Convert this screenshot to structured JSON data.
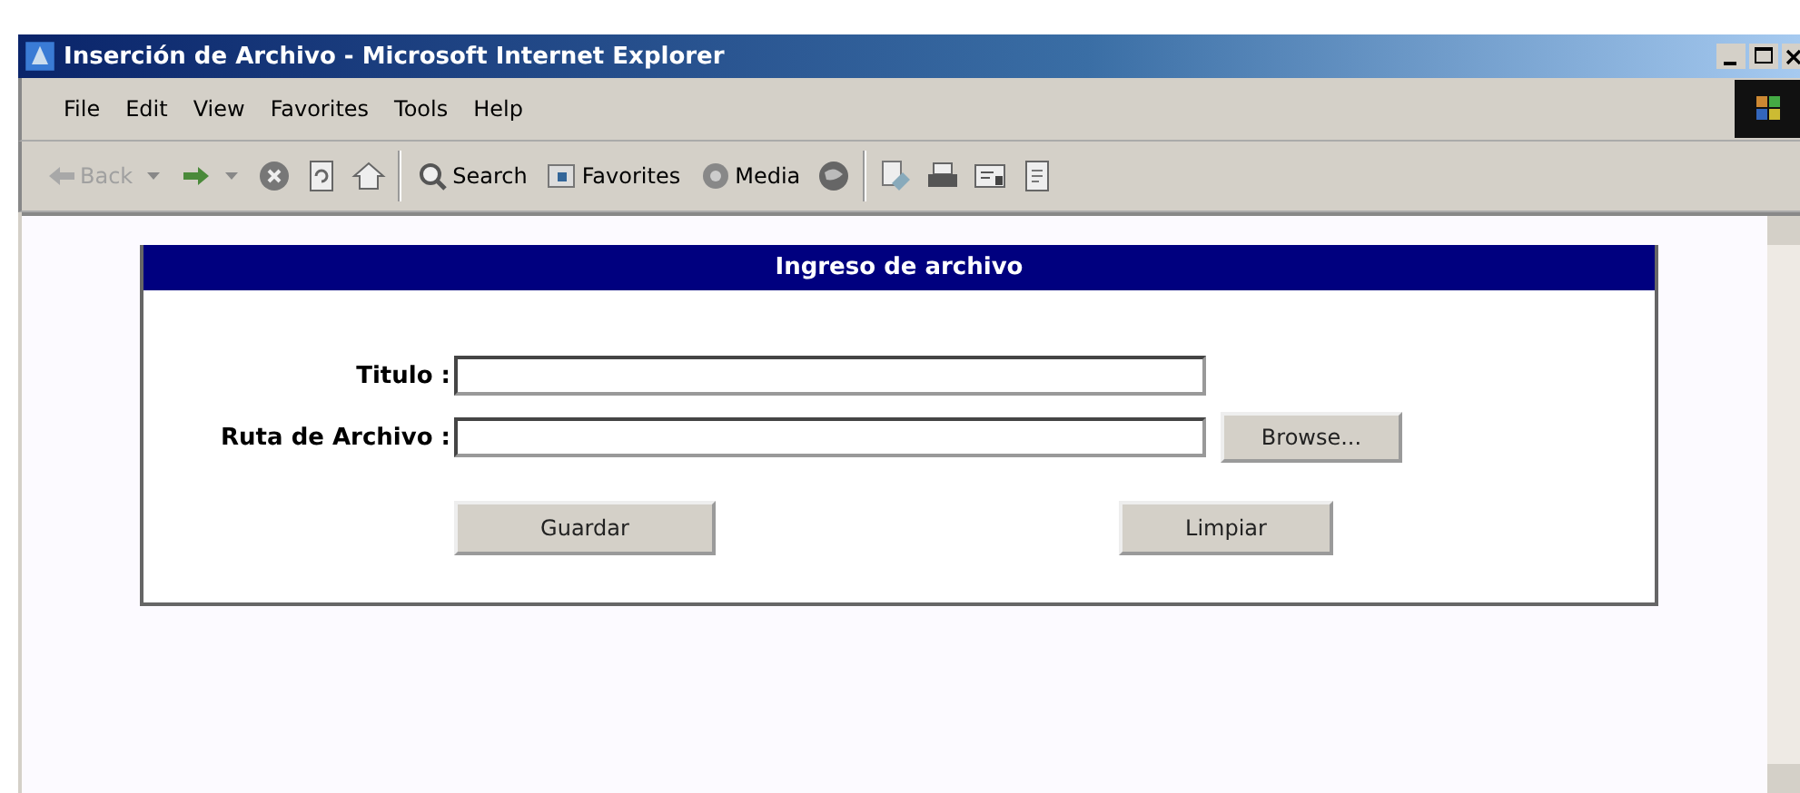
{
  "window": {
    "title": "Inserción de Archivo - Microsoft Internet Explorer"
  },
  "menu": [
    "File",
    "Edit",
    "View",
    "Favorites",
    "Tools",
    "Help"
  ],
  "toolbar": [
    {
      "kind": "back",
      "label": "Back",
      "disabled": true
    },
    {
      "kind": "forward",
      "disabled": false
    },
    {
      "kind": "stop"
    },
    {
      "kind": "refresh"
    },
    {
      "kind": "home"
    },
    {
      "kind": "separator"
    },
    {
      "kind": "search",
      "label": "Search"
    },
    {
      "kind": "favorites",
      "label": "Favorites"
    },
    {
      "kind": "media",
      "label": "Media"
    },
    {
      "kind": "history"
    },
    {
      "kind": "separator"
    },
    {
      "kind": "mail"
    },
    {
      "kind": "print"
    },
    {
      "kind": "edit"
    },
    {
      "kind": "discuss"
    }
  ],
  "form": {
    "title": "Ingreso de archivo",
    "fields": [
      {
        "kind": "text",
        "label": "Titulo :"
      },
      {
        "kind": "file",
        "label": "Ruta de Archivo :",
        "button": "Browse..."
      }
    ],
    "buttons": [
      "Guardar",
      "Limpiar"
    ]
  }
}
